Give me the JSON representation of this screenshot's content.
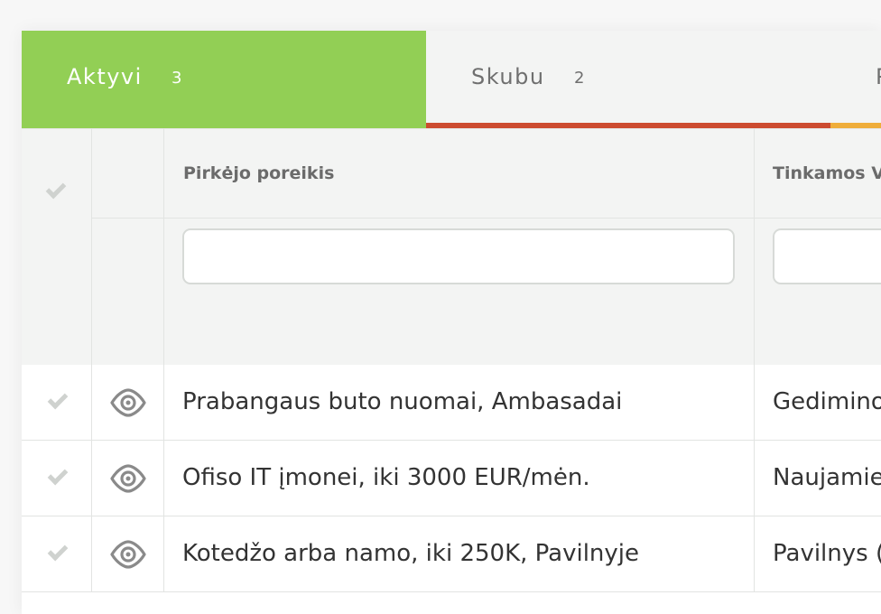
{
  "tabs": [
    {
      "label": "Aktyvi",
      "count": "3"
    },
    {
      "label": "Skubu",
      "count": "2"
    },
    {
      "label": "P",
      "count": ""
    }
  ],
  "colors": {
    "active_tab": "#92cf55",
    "urgent_tab_underline": "#cc4b30",
    "third_tab_underline": "#efad3a",
    "header_bg": "#f3f4f3"
  },
  "table": {
    "columns": [
      {
        "label": "Pirkėjo poreikis"
      },
      {
        "label": "Tinkamos V"
      }
    ],
    "filters": [
      {
        "value": "",
        "placeholder": ""
      },
      {
        "value": "",
        "placeholder": ""
      }
    ],
    "rows": [
      {
        "need": "Prabangaus buto nuomai, Ambasadai",
        "object": "Gedimino"
      },
      {
        "need": "Ofiso IT įmonei, iki 3000 EUR/mėn.",
        "object": "Naujamie"
      },
      {
        "need": "Kotedžo arba namo, iki 250K, Pavilnyje",
        "object": "Pavilnys ("
      }
    ]
  },
  "icons": {
    "select_all": "check-icon",
    "row_select": "check-icon",
    "row_view": "eye-icon"
  }
}
